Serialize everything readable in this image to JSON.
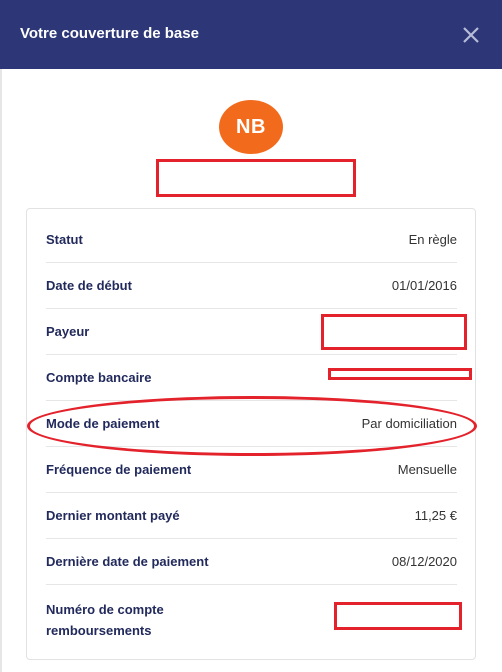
{
  "dialog": {
    "title": "Votre couverture de base",
    "close_icon": "close-icon"
  },
  "avatar": {
    "initials": "NB",
    "color": "#f26b1d"
  },
  "colors": {
    "header_bg": "#2d3777",
    "label_text": "#222a5c",
    "annotation_red": "#e3222b"
  },
  "details": {
    "statut": {
      "label": "Statut",
      "value": "En règle"
    },
    "date_debut": {
      "label": "Date de début",
      "value": "01/01/2016"
    },
    "payeur": {
      "label": "Payeur",
      "value": ""
    },
    "compte_bancaire": {
      "label": "Compte bancaire",
      "value": ""
    },
    "mode_paiement": {
      "label": "Mode de paiement",
      "value": "Par domiciliation"
    },
    "frequence": {
      "label": "Fréquence de paiement",
      "value": "Mensuelle"
    },
    "dernier_montant": {
      "label": "Dernier montant payé",
      "value": "11,25 €"
    },
    "derniere_date": {
      "label": "Dernière date de paiement",
      "value": "08/12/2020"
    },
    "numero_compte": {
      "label": "Numéro de compte remboursements",
      "value": ""
    }
  }
}
